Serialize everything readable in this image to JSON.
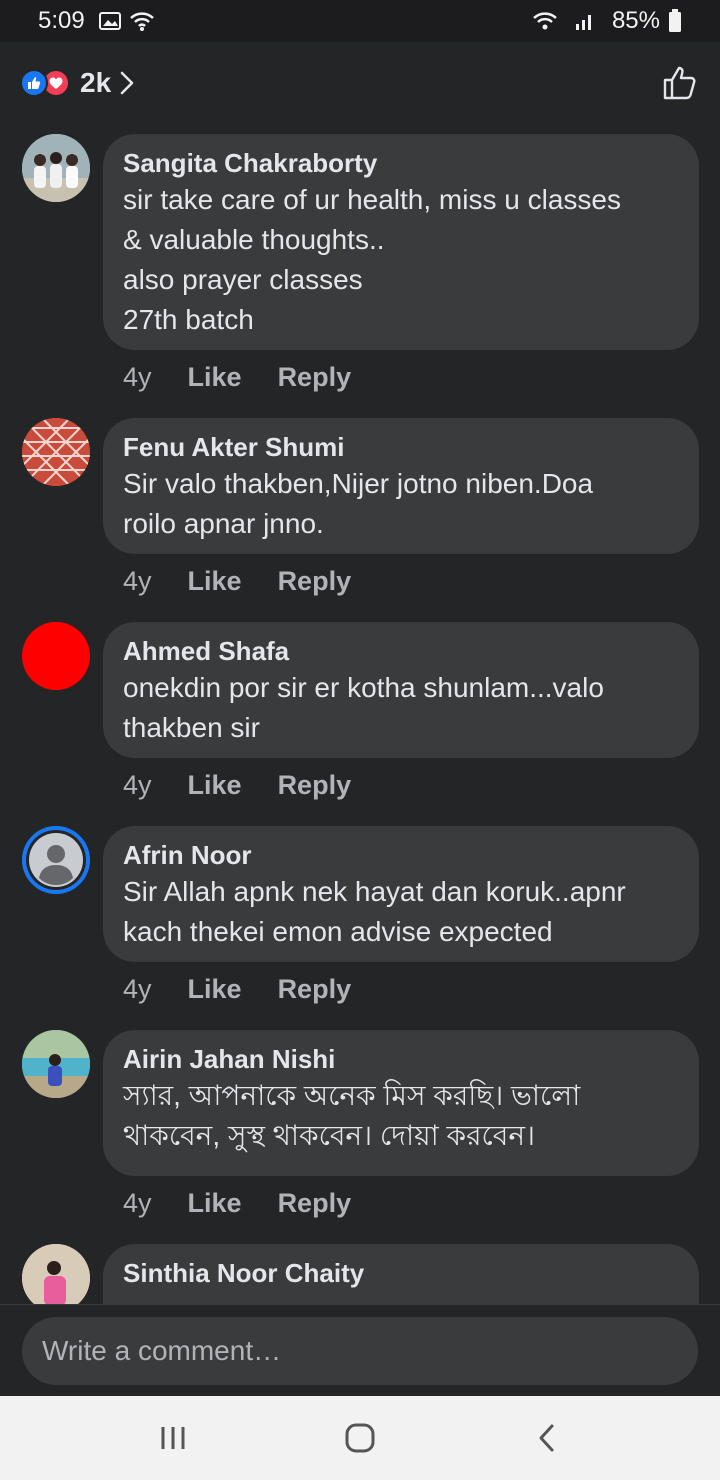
{
  "status_bar": {
    "time": "5:09",
    "battery": "85%"
  },
  "header": {
    "reaction_count": "2k"
  },
  "colors": {
    "like_blue": "#1877f2",
    "love_red": "#f33e58",
    "bubble": "#3a3b3c",
    "background": "#242526"
  },
  "comments": [
    {
      "name": "Sangita Chakraborty",
      "text": "sir take care of ur health, miss u classes\n& valuable thoughts..\nalso prayer classes\n27th batch",
      "time": "4y",
      "like": "Like",
      "reply": "Reply",
      "avatar": "group-photo-avatar"
    },
    {
      "name": "Fenu Akter Shumi",
      "text": "Sir valo thakben,Nijer jotno niben.Doa\nroilo apnar jnno.",
      "time": "4y",
      "like": "Like",
      "reply": "Reply",
      "avatar": "red-pattern-avatar"
    },
    {
      "name": "Ahmed Shafa",
      "text": "onekdin por sir er kotha shunlam...valo\nthakben sir",
      "time": "4y",
      "like": "Like",
      "reply": "Reply",
      "avatar": "red-circle-avatar"
    },
    {
      "name": "Afrin Noor",
      "text": "Sir Allah apnk nek hayat dan koruk..apnr\nkach thekei emon advise expected",
      "time": "4y",
      "like": "Like",
      "reply": "Reply",
      "avatar": "default-person-avatar"
    },
    {
      "name": "Airin Jahan Nishi",
      "text": "স্যার, আপনাকে অনেক মিস করছি। ভালো\nথাকবেন, সুস্থ থাকবেন। দোয়া করবেন।",
      "time": "4y",
      "like": "Like",
      "reply": "Reply",
      "avatar": "outdoor-photo-avatar"
    },
    {
      "name": "Sinthia Noor Chaity",
      "text": "",
      "avatar": "pink-photo-avatar"
    }
  ],
  "composer": {
    "placeholder": "Write a comment…"
  }
}
